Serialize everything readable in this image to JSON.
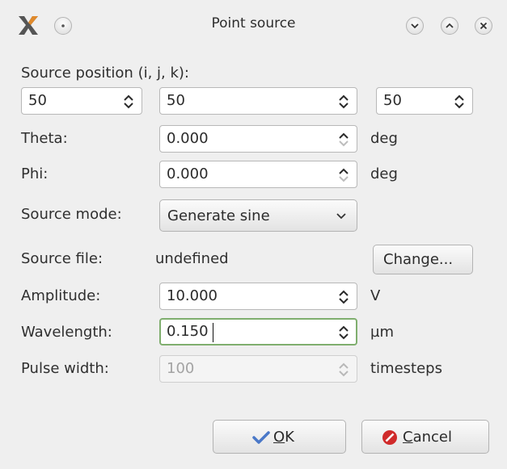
{
  "window": {
    "title": "Point source"
  },
  "form": {
    "position_label": "Source position (i, j, k):",
    "position_i": "50",
    "position_j": "50",
    "position_k": "50",
    "theta_label": "Theta:",
    "theta_value": "0.000",
    "theta_unit": "deg",
    "phi_label": "Phi:",
    "phi_value": "0.000",
    "phi_unit": "deg",
    "mode_label": "Source mode:",
    "mode_value": "Generate sine",
    "file_label": "Source file:",
    "file_value": "undefined",
    "change_button": "Change...",
    "amplitude_label": "Amplitude:",
    "amplitude_value": "10.000",
    "amplitude_unit": "V",
    "wavelength_label": "Wavelength:",
    "wavelength_value": "0.150",
    "wavelength_unit": "µm",
    "pulse_label": "Pulse width:",
    "pulse_value": "100",
    "pulse_unit": "timesteps"
  },
  "buttons": {
    "ok_underlined": "O",
    "ok_rest": "K",
    "cancel_underlined": "C",
    "cancel_rest": "ancel"
  },
  "colors": {
    "dialog_bg": "#efefef",
    "focus_border": "#7fae6e",
    "ok_check": "#4a78c8",
    "cancel_icon": "#d02a2a"
  },
  "icons": [
    "app-icon",
    "window-menu-icon",
    "minimize-icon",
    "maximize-icon",
    "close-icon",
    "spin-arrows-icon",
    "dropdown-arrow-icon",
    "check-icon",
    "cancel-icon"
  ]
}
